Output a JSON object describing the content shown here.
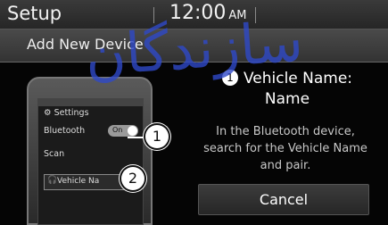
{
  "header": {
    "title": "Setup",
    "time": "12:00",
    "ampm": "AM"
  },
  "subheader": {
    "title": "Add New Device"
  },
  "phone": {
    "settings_label": "Settings",
    "bluetooth_label": "Bluetooth",
    "toggle_label": "On",
    "scan_label": "Scan",
    "device_label": "Vehicle Na"
  },
  "callouts": {
    "one": "1",
    "two": "2"
  },
  "step": {
    "number": "1",
    "title": "Vehicle Name:",
    "name": "Name"
  },
  "instruction": {
    "line1": "In the Bluetooth device,",
    "line2": "search for the Vehicle Name",
    "line3": "and pair."
  },
  "buttons": {
    "cancel": "Cancel"
  },
  "watermark": {
    "text": "ﺳﺎﺯﻧﺪﮔﺎﻥ",
    "color": "#2f49c8"
  }
}
